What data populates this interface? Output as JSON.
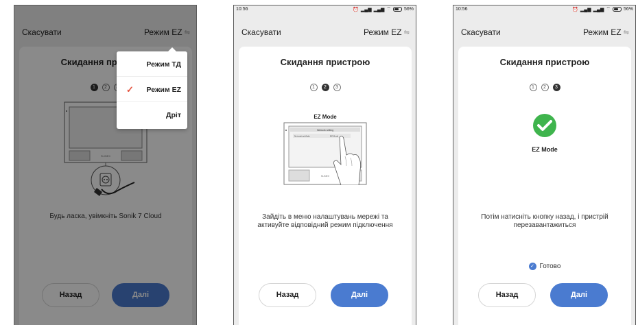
{
  "screens": [
    {
      "cancel": "Скасувати",
      "mode": "Режим EZ",
      "title": "Скидання пристрою",
      "steps": [
        "1",
        "2",
        "3"
      ],
      "description": "Будь ласка, увімкніть Sonik 7 Cloud",
      "back": "Назад",
      "next": "Далі",
      "menu": [
        {
          "label": "Режим ТД",
          "selected": false
        },
        {
          "label": "Режим EZ",
          "selected": true
        },
        {
          "label": "Дріт",
          "selected": false
        }
      ]
    },
    {
      "time": "10:56",
      "battery": "56%",
      "cancel": "Скасувати",
      "mode": "Режим EZ",
      "title": "Скидання пристрою",
      "steps": [
        "1",
        "2",
        "3"
      ],
      "illustration_title": "EZ Mode",
      "illustration_header": "Network setting",
      "illustration_row_left": "Net pairing Mode",
      "illustration_row_right": "EZ Mode",
      "description": "Зайдіть в меню налаштувань мережі та активуйте відповідний режим підключення",
      "back": "Назад",
      "next": "Далі"
    },
    {
      "time": "10:56",
      "battery": "56%",
      "cancel": "Скасувати",
      "mode": "Режим EZ",
      "title": "Скидання пристрою",
      "steps": [
        "1",
        "2",
        "3"
      ],
      "illustration_title": "EZ Mode",
      "description": "Потім натисніть кнопку назад, і пристрій перезавантажиться",
      "ready": "Готово",
      "back": "Назад",
      "next": "Далі"
    }
  ],
  "colors": {
    "accent": "#4a7bd0",
    "success": "#3fb44d",
    "check": "#e5543f"
  }
}
